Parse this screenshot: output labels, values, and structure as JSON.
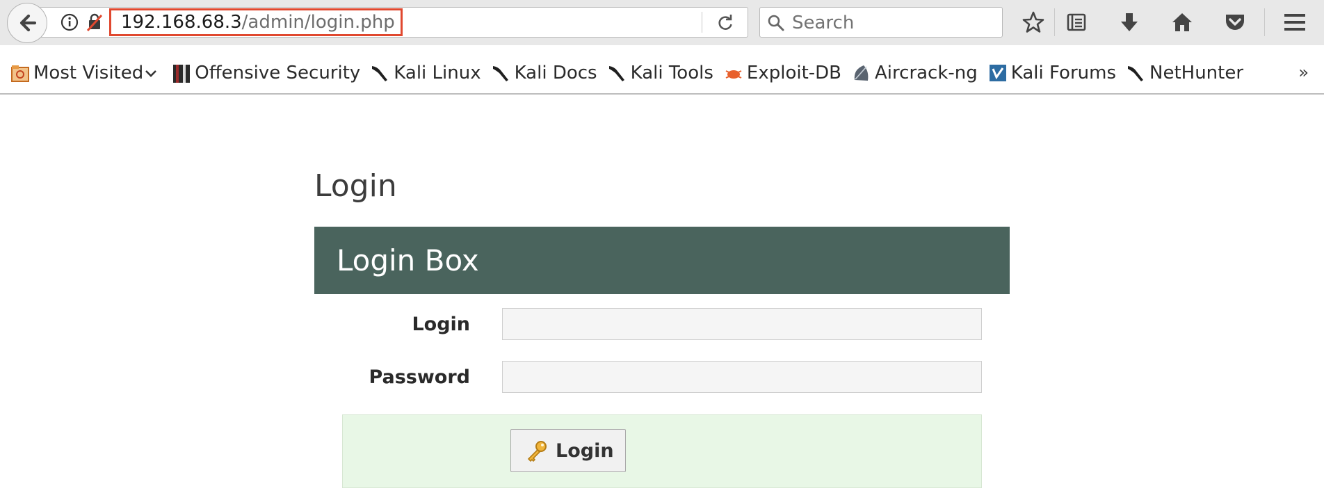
{
  "browser": {
    "url_host": "192.168.68.3",
    "url_path": "/admin/login.php",
    "search_placeholder": "Search"
  },
  "bookmarks": [
    {
      "label": "Most Visited",
      "icon": "most-visited-icon"
    },
    {
      "label": "Offensive Security",
      "icon": "offensive-security-icon"
    },
    {
      "label": "Kali Linux",
      "icon": "kali-dragon-icon"
    },
    {
      "label": "Kali Docs",
      "icon": "kali-dragon-icon"
    },
    {
      "label": "Kali Tools",
      "icon": "kali-dragon-icon"
    },
    {
      "label": "Exploit-DB",
      "icon": "exploit-db-icon"
    },
    {
      "label": "Aircrack-ng",
      "icon": "aircrack-icon"
    },
    {
      "label": "Kali Forums",
      "icon": "kali-forums-icon"
    },
    {
      "label": "NetHunter",
      "icon": "kali-dragon-icon"
    }
  ],
  "bookmarks_overflow": "»",
  "page": {
    "title": "Login",
    "box_title": "Login Box",
    "login_label": "Login",
    "login_value": "",
    "password_label": "Password",
    "password_value": "",
    "submit_label": "Login"
  },
  "colors": {
    "header_bg": "#4a645d",
    "submit_area_bg": "#e8f7e6",
    "url_highlight": "#e0482f"
  }
}
